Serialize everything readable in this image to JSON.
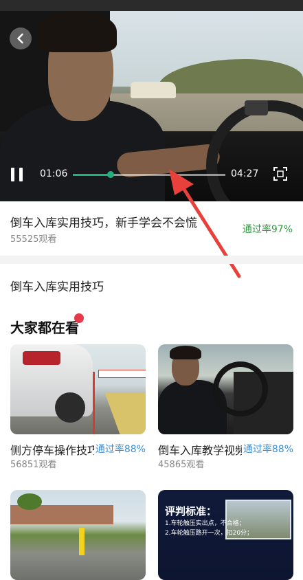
{
  "player": {
    "current_time": "01:06",
    "total_time": "04:27",
    "progress": 0.247,
    "accent_color": "#22b07d",
    "icons": {
      "back": "chevron-left-icon",
      "pause": "pause-icon",
      "fullscreen": "fullscreen-icon"
    }
  },
  "video": {
    "title": "倒车入库实用技巧，新手学会不会慌",
    "views": "55525观看",
    "pass_rate": "通过率97%"
  },
  "tag": "倒车入库实用技巧",
  "section": {
    "title": "大家都在看"
  },
  "cards": [
    {
      "title": "侧方停车操作技巧",
      "pass_rate": "通过率88%",
      "views": "56851观看"
    },
    {
      "title": "倒车入库教学视频",
      "pass_rate": "通过率88%",
      "views": "45865观看"
    },
    {
      "title": "",
      "pass_rate": "",
      "views": ""
    },
    {
      "title": "",
      "pass_rate": "",
      "views": ""
    }
  ],
  "thumbnail_texts": {
    "card4_heading": "评判标准：",
    "card4_line1": "1.车轮触压实出点，不合格；",
    "card4_line2": "2.车轮触压路开一次，扣20分；"
  }
}
